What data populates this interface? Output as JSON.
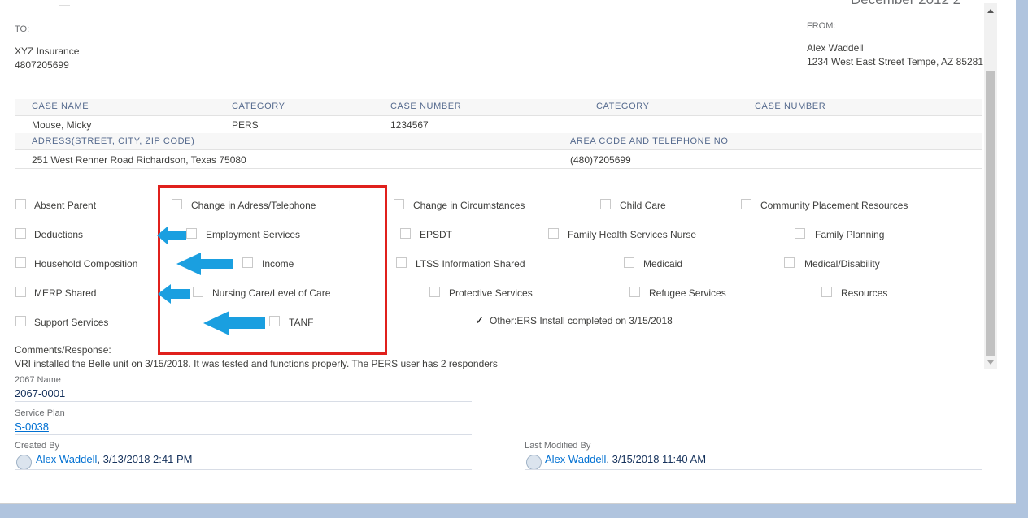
{
  "header": {
    "date_fragment": "December 2012 2",
    "to_label": "TO:",
    "to_name": "XYZ Insurance",
    "to_phone": "4807205699",
    "from_label": "FROM:",
    "from_name": "Alex Waddell",
    "from_address": "1234 West East Street Tempe, AZ 85281"
  },
  "case_table": {
    "headers": [
      "CASE NAME",
      "CATEGORY",
      "CASE NUMBER",
      "CATEGORY",
      "CASE NUMBER"
    ],
    "values": [
      "Mouse, Micky",
      "PERS",
      "1234567"
    ],
    "address_label": "ADRESS(STREET, CITY, ZIP CODE)",
    "phone_label": "AREA CODE AND TELEPHONE NO",
    "address_value": "251 West Renner Road Richardson, Texas 75080",
    "phone_value": "(480)7205699"
  },
  "checkboxes": [
    {
      "label": "Absent Parent",
      "checked": false
    },
    {
      "label": "Change in Adress/Telephone",
      "checked": false
    },
    {
      "label": "Change in Circumstances",
      "checked": false
    },
    {
      "label": "Child Care",
      "checked": false
    },
    {
      "label": "Community Placement Resources",
      "checked": false
    },
    {
      "label": "Deductions",
      "checked": false
    },
    {
      "label": "Employment Services",
      "checked": false
    },
    {
      "label": "EPSDT",
      "checked": false
    },
    {
      "label": "Family Health Services Nurse",
      "checked": false
    },
    {
      "label": "Family Planning",
      "checked": false
    },
    {
      "label": "Household Composition",
      "checked": false
    },
    {
      "label": "Income",
      "checked": false
    },
    {
      "label": "LTSS Information Shared",
      "checked": false
    },
    {
      "label": "Medicaid",
      "checked": false
    },
    {
      "label": "Medical/Disability",
      "checked": false
    },
    {
      "label": "MERP Shared",
      "checked": false
    },
    {
      "label": "Nursing Care/Level of Care",
      "checked": false
    },
    {
      "label": "Protective Services",
      "checked": false
    },
    {
      "label": "Refugee Services",
      "checked": false
    },
    {
      "label": "Resources",
      "checked": false
    },
    {
      "label": "Support Services",
      "checked": false
    },
    {
      "label": "TANF",
      "checked": false
    },
    {
      "label": "Other:ERS Install completed on 3/15/2018",
      "checked": true
    }
  ],
  "checkmark_glyph": "✓",
  "comments": {
    "label": "Comments/Response:",
    "text": "VRI installed the Belle unit on 3/15/2018. It was tested and functions properly. The PERS user has 2 responders"
  },
  "fields": {
    "name_label": "2067 Name",
    "name_value": "2067-0001",
    "service_plan_label": "Service Plan",
    "service_plan_value": "S-0038",
    "created_by_label": "Created By",
    "created_by_user": "Alex Waddell",
    "created_by_date": ", 3/13/2018 2:41 PM",
    "modified_by_label": "Last Modified By",
    "modified_by_user": "Alex Waddell",
    "modified_by_date": ", 3/15/2018 11:40 AM"
  },
  "colors": {
    "highlight_box": "#e0201c",
    "annotation_arrow": "#1a9fe0",
    "link": "#0070d2",
    "page_background": "#b0c4de"
  },
  "icons": {
    "annotation": "arrow-left-icon",
    "user": "user-avatar-icon",
    "scroll_up": "scroll-up-icon",
    "scroll_down": "scroll-down-icon"
  }
}
